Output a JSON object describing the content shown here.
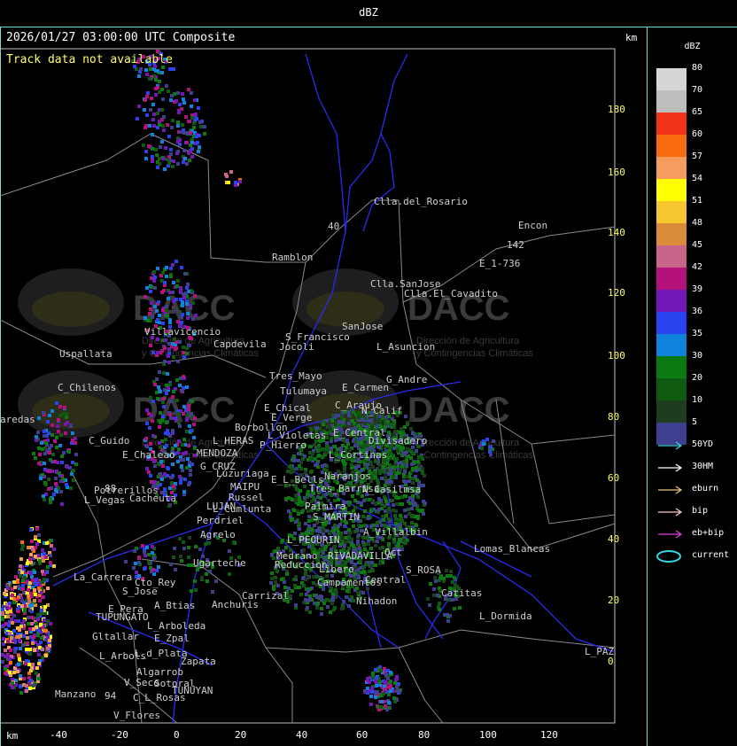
{
  "header": {
    "title": "dBZ"
  },
  "map": {
    "timestamp_label": "2026/01/27 03:00:00 UTC Composite",
    "status_message": "Track data not available",
    "unit_top": "km",
    "unit_bottom": "km",
    "y_ticks": [
      "180",
      "160",
      "140",
      "120",
      "100",
      "80",
      "60",
      "40",
      "20",
      "0"
    ],
    "x_ticks": [
      "-40",
      "-20",
      "0",
      "20",
      "40",
      "60",
      "80",
      "100",
      "120"
    ],
    "watermark": {
      "name": "DACC",
      "subtitle_line1": "Dirección de Agricultura",
      "subtitle_line2": "y Contingencias Climáticas"
    },
    "places": [
      {
        "label": "Clla.del_Rosario"
      },
      {
        "label": "Encon"
      },
      {
        "label": "142"
      },
      {
        "label": "E_1-736"
      },
      {
        "label": "Ramblon"
      },
      {
        "label": "Clla.SanJose"
      },
      {
        "label": "Clla.El_Cavadito"
      },
      {
        "label": "Villavicencio"
      },
      {
        "label": "Capdevila"
      },
      {
        "label": "S_Francisco"
      },
      {
        "label": "SanJose"
      },
      {
        "label": "L_Asuncion"
      },
      {
        "label": "Uspallata"
      },
      {
        "label": "Jocoli"
      },
      {
        "label": "Tres_Mayo"
      },
      {
        "label": "G_Andre"
      },
      {
        "label": "C_Chilenos"
      },
      {
        "label": "Tulumaya"
      },
      {
        "label": "E_Carmen"
      },
      {
        "label": "E_Chical"
      },
      {
        "label": "C_Araujo"
      },
      {
        "label": "N_Calif"
      },
      {
        "label": "E_Verge"
      },
      {
        "label": "aredas"
      },
      {
        "label": "Borbollon"
      },
      {
        "label": "E_Central"
      },
      {
        "label": "L_Violetas"
      },
      {
        "label": "C_Guido"
      },
      {
        "label": "L_HERAS"
      },
      {
        "label": "P_Hierro"
      },
      {
        "label": "Divisadero"
      },
      {
        "label": "E_Chaleao"
      },
      {
        "label": "MENDOZA"
      },
      {
        "label": "L_Cortinas"
      },
      {
        "label": "G_CRUZ"
      },
      {
        "label": "Luzuriaga"
      },
      {
        "label": "Naranjos"
      },
      {
        "label": "E_L_Bells"
      },
      {
        "label": "MAIPU"
      },
      {
        "label": "Potrerillos"
      },
      {
        "label": "Tres_Barrisa"
      },
      {
        "label": "N_Casilmsa"
      },
      {
        "label": "Cacheuta"
      },
      {
        "label": "L_Vegas"
      },
      {
        "label": "Russel"
      },
      {
        "label": "Palmira"
      },
      {
        "label": "LUJAN"
      },
      {
        "label": "L_Cumlunta"
      },
      {
        "label": "S_MARTIN"
      },
      {
        "label": "Perdriel"
      },
      {
        "label": "A_Villalbin"
      },
      {
        "label": "Agrelo"
      },
      {
        "label": "L_PEOURIN"
      },
      {
        "label": "Lomas_Blancas"
      },
      {
        "label": "Ugarteche"
      },
      {
        "label": "Medrano"
      },
      {
        "label": "RIVADAVILLA"
      },
      {
        "label": "Oct"
      },
      {
        "label": "La_Carrera"
      },
      {
        "label": "Reduccion"
      },
      {
        "label": "Libero"
      },
      {
        "label": "Cto_Rey"
      },
      {
        "label": "Campamentos"
      },
      {
        "label": "Central"
      },
      {
        "label": "S_ROSA"
      },
      {
        "label": "S_Jose"
      },
      {
        "label": "Carrizal"
      },
      {
        "label": "Catitas"
      },
      {
        "label": "E_Pera"
      },
      {
        "label": "A_Btias"
      },
      {
        "label": "Anchuris"
      },
      {
        "label": "Nihadon"
      },
      {
        "label": "TUPUNGATO"
      },
      {
        "label": "L_Dormida"
      },
      {
        "label": "L_Arboleda"
      },
      {
        "label": "Gltallar"
      },
      {
        "label": "E_Zpal"
      },
      {
        "label": "L_PAZ"
      },
      {
        "label": "L_Arbols"
      },
      {
        "label": "L_d_Plata"
      },
      {
        "label": "Zapata"
      },
      {
        "label": "Algarrob"
      },
      {
        "label": "V_Seco"
      },
      {
        "label": "Sotoral"
      },
      {
        "label": "TUNUYAN"
      },
      {
        "label": "Manzano"
      },
      {
        "label": "C_L_Rosas"
      },
      {
        "label": "V_Flores"
      },
      {
        "label": "40"
      },
      {
        "label": "88"
      },
      {
        "label": "94"
      }
    ]
  },
  "legend": {
    "title": "dBZ",
    "bins": [
      {
        "label": "80",
        "color": "#d6d6d6"
      },
      {
        "label": "70",
        "color": "#bdbdbd"
      },
      {
        "label": "65",
        "color": "#f03218"
      },
      {
        "label": "60",
        "color": "#f76a0f"
      },
      {
        "label": "57",
        "color": "#f59c5e"
      },
      {
        "label": "54",
        "color": "#ffff00"
      },
      {
        "label": "51",
        "color": "#f6c631"
      },
      {
        "label": "48",
        "color": "#d98b3a"
      },
      {
        "label": "45",
        "color": "#c9648a"
      },
      {
        "label": "42",
        "color": "#b5117a"
      },
      {
        "label": "39",
        "color": "#7218b6"
      },
      {
        "label": "36",
        "color": "#2a43ee"
      },
      {
        "label": "35",
        "color": "#0f82db"
      },
      {
        "label": "30",
        "color": "#0b7a11"
      },
      {
        "label": "20",
        "color": "#0e5a11"
      },
      {
        "label": "10",
        "color": "#1d3d1e"
      },
      {
        "label": "5",
        "color": "#3f3f90"
      }
    ],
    "tracks": [
      {
        "label": "50YD",
        "color": "#3fd6d6"
      },
      {
        "label": "30HM",
        "color": "#ffffff"
      },
      {
        "label": "eburn",
        "color": "#e8c77a"
      },
      {
        "label": "bip",
        "color": "#ffc8c8"
      },
      {
        "label": "eb+bip",
        "color": "#e040e0"
      },
      {
        "label": "current",
        "color": "#2fd8e8"
      }
    ]
  }
}
